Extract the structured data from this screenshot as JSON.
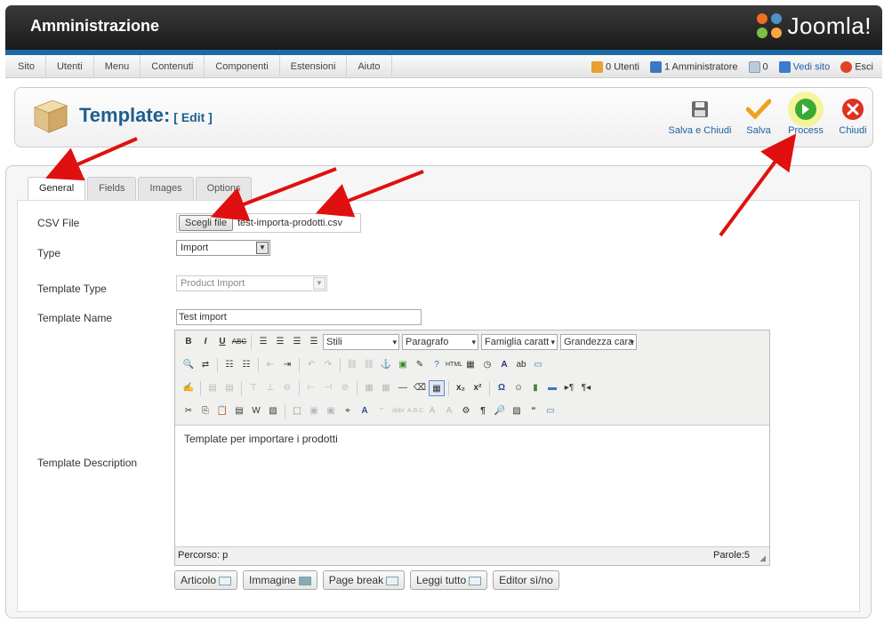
{
  "header": {
    "title": "Amministrazione",
    "logo_text": "Joomla!"
  },
  "menu": [
    "Sito",
    "Utenti",
    "Menu",
    "Contenuti",
    "Componenti",
    "Estensioni",
    "Aiuto"
  ],
  "status": {
    "users": "0 Utenti",
    "admins": "1 Amministratore",
    "messages": "0",
    "view_site": "Vedi sito",
    "logout": "Esci"
  },
  "toolbar": {
    "title": "Template:",
    "subtitle": "[ Edit ]",
    "save_close": "Salva e Chiudi",
    "save": "Salva",
    "process": "Process",
    "close": "Chiudi"
  },
  "tabs": [
    "General",
    "Fields",
    "Images",
    "Options"
  ],
  "form": {
    "csv_label": "CSV File",
    "choose_file": "Scegli file",
    "file_name": "test-importa-prodotti.csv",
    "type_label": "Type",
    "type_value": "Import",
    "template_type_label": "Template Type",
    "template_type_value": "Product Import",
    "template_name_label": "Template Name",
    "template_name_value": "Test import",
    "description_label": "Template Description"
  },
  "editor": {
    "styles": "Stili",
    "format": "Paragrafo",
    "font_family": "Famiglia caratt",
    "font_size": "Grandezza cara",
    "content": "Template per importare i prodotti",
    "path": "Percorso: p",
    "words": "Parole:5"
  },
  "buttons": [
    "Articolo",
    "Immagine",
    "Page break",
    "Leggi tutto",
    "Editor sì/no"
  ],
  "colors": {
    "header_bg": "#222222",
    "accent_blue": "#1b6aa5",
    "title_blue": "#1e5f8e",
    "arrow_red": "#e01010",
    "save_orange": "#f0a020",
    "process_green": "#3aaa35",
    "close_red": "#e03020"
  }
}
